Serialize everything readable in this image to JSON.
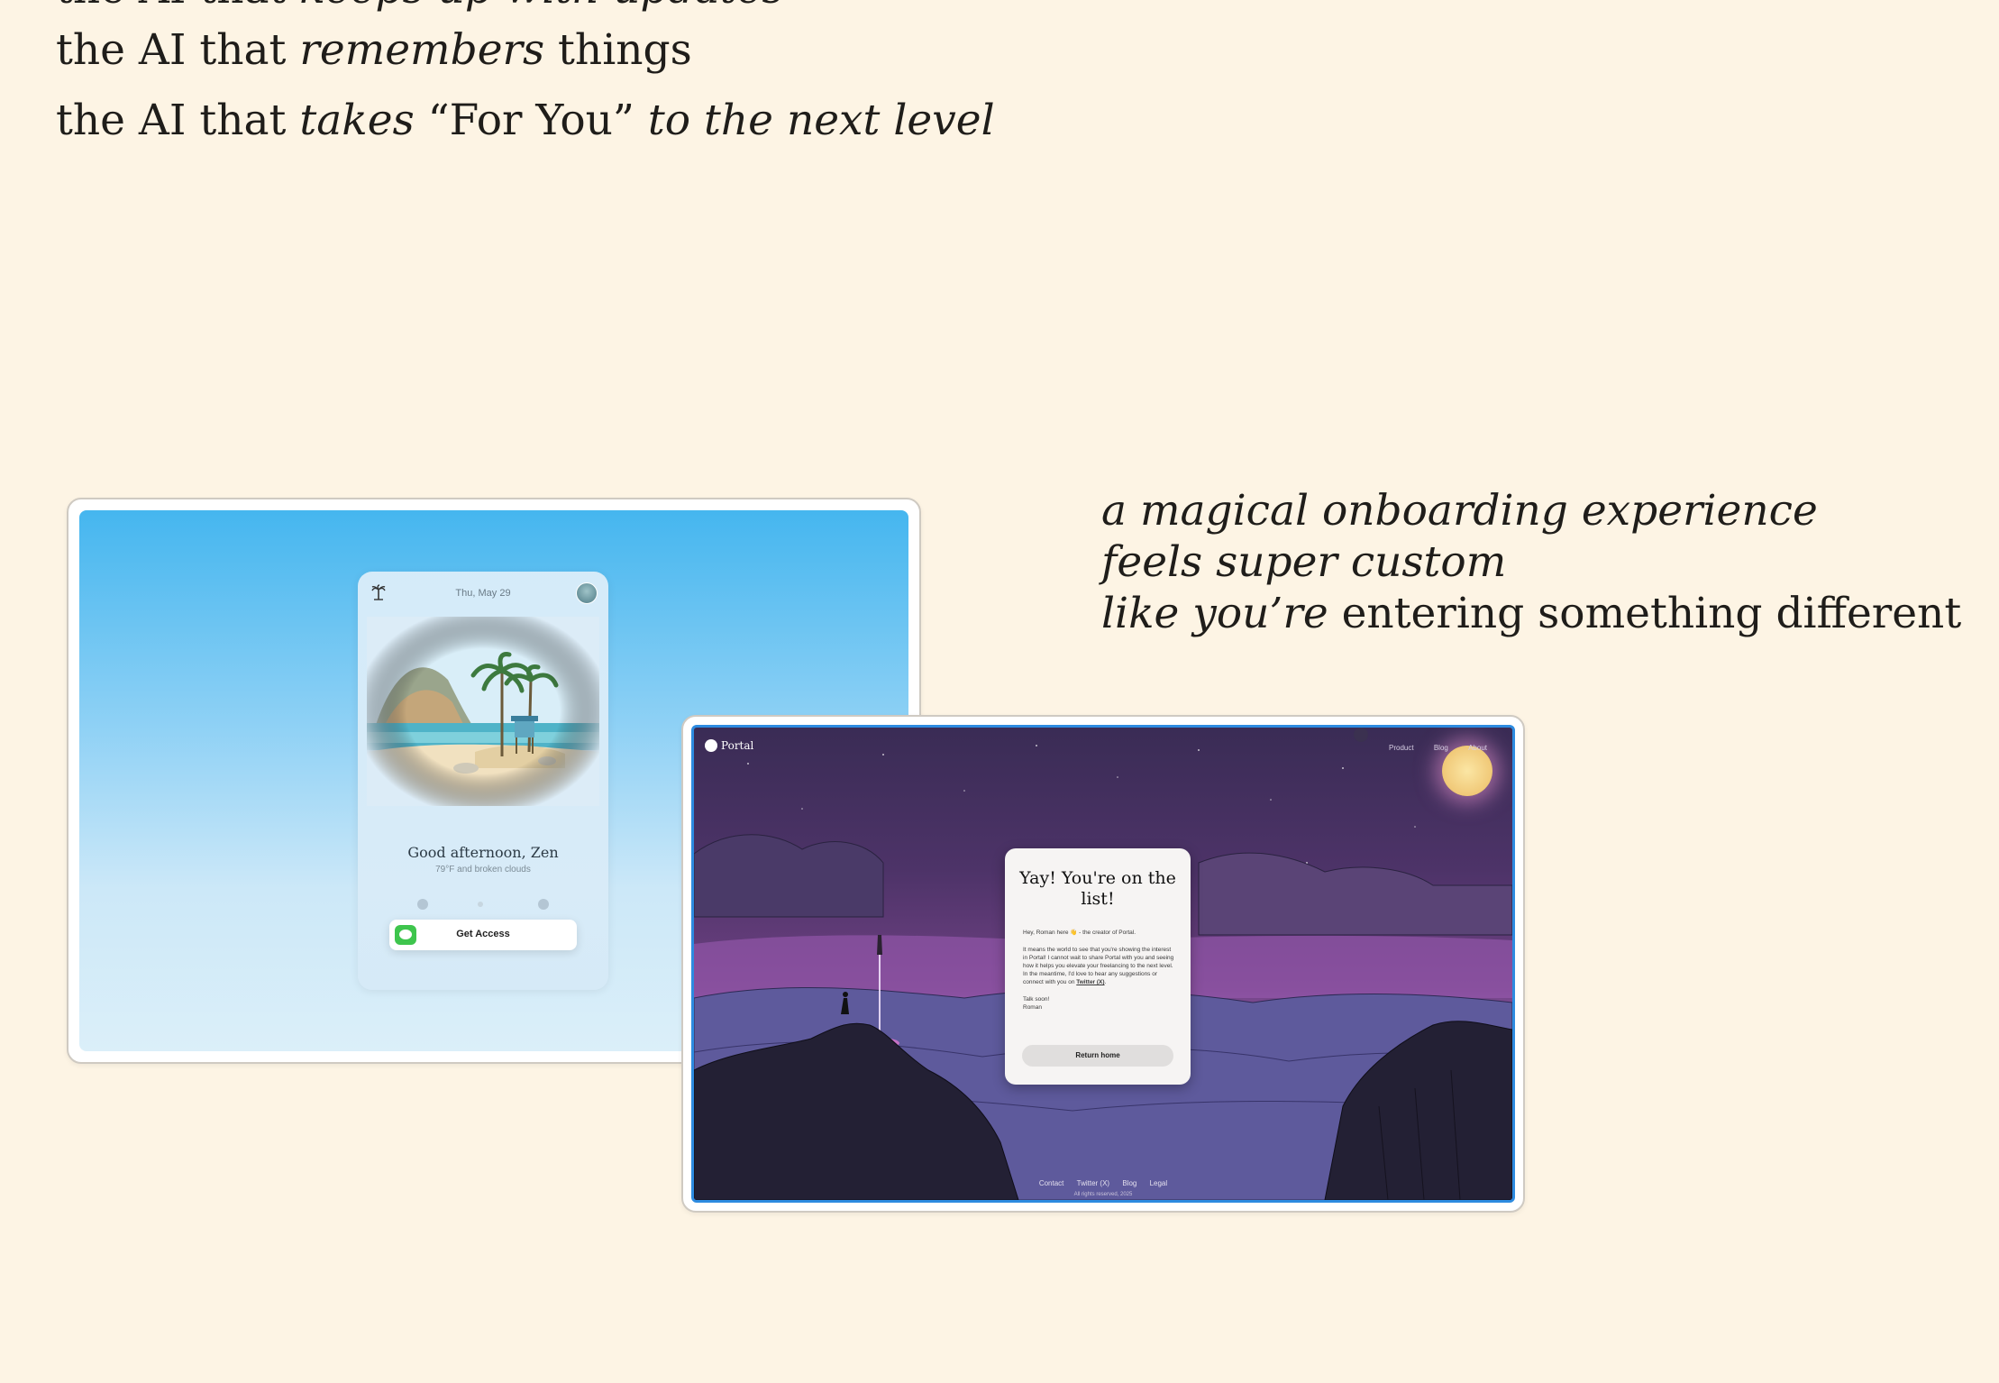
{
  "hero": {
    "line0": {
      "a": "the AI that ",
      "b": "keeps up with updates",
      "c": ""
    },
    "line1": {
      "a": "the AI that ",
      "b": "remembers",
      "c": " things"
    },
    "line2": {
      "a": "the AI that ",
      "b": "takes",
      "c": " “For You” ",
      "d": "to the next level"
    }
  },
  "tagline": {
    "line1": "a magical onboarding experience",
    "line2": "feels super custom",
    "line3_italic": "like you’re",
    "line3_rest": " entering something different"
  },
  "weather_app": {
    "date": "Thu, May 29",
    "greeting": "Good afternoon, Zen",
    "weather": "79°F and broken clouds",
    "cta": "Get Access",
    "icons": {
      "top_left": "palm-tree-icon",
      "top_right": "avatar",
      "cta": "messages-icon"
    }
  },
  "portal_site": {
    "brand": "Portal",
    "nav": [
      "Product",
      "Blog",
      "About"
    ],
    "card": {
      "title": "Yay! You're on the list!",
      "p1": "Hey, Roman here 👋 - the creator of Portal.",
      "p2": "It means the world to see that you're showing the interest in Portal! I cannot wait to share Portal with you and seeing how it helps you elevate your freelancing to the next level.",
      "p3_prefix": "In the meantime, I'd love to hear any suggestions or connect with you on ",
      "p3_link": "Twitter (X)",
      "p4": "Talk soon!",
      "p5": "Roman",
      "button": "Return home"
    },
    "footer": [
      "Contact",
      "Twitter (X)",
      "Blog",
      "Legal"
    ],
    "copyright": "All rights reserved, 2025",
    "colors": {
      "accent_border": "#2d8be0",
      "moon": "#f0c877"
    }
  }
}
